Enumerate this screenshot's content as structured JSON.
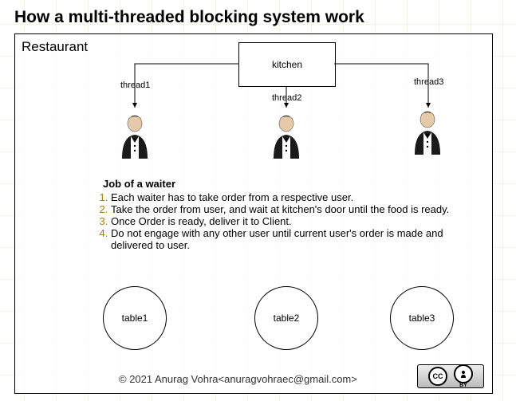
{
  "title": "How a multi-threaded blocking system work",
  "frame_label": "Restaurant",
  "kitchen_label": "kitchen",
  "threads": {
    "t1": "thread1",
    "t2": "thread2",
    "t3": "thread3"
  },
  "job_title": "Job of a waiter",
  "job_steps": {
    "s1": "Each waiter has to take order from a respective user.",
    "s2": "Take the order from user, and wait at kitchen's door until the food is ready.",
    "s3": "Once Order is ready, deliver it to Client.",
    "s4": "Do not engage with any other user until current user's order is made and delivered to user."
  },
  "tables": {
    "t1": "table1",
    "t2": "table2",
    "t3": "table3"
  },
  "copyright": "© 2021 Anurag Vohra<anuragvohraec@gmail.com>",
  "cc": {
    "left": "CC",
    "right_icon": "person-icon",
    "label": "BY"
  }
}
